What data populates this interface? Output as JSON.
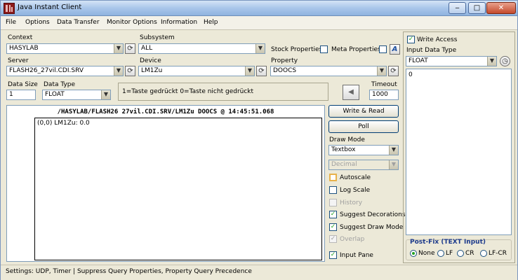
{
  "window": {
    "title": "Java Instant Client",
    "minimize": "‒",
    "maximize": "□",
    "close": "✕"
  },
  "menu": [
    "File",
    "Options",
    "Data Transfer",
    "Monitor Options",
    "Information",
    "Help"
  ],
  "context": {
    "label": "Context",
    "value": "HASYLAB"
  },
  "subsystem": {
    "label": "Subsystem",
    "value": "ALL"
  },
  "server": {
    "label": "Server",
    "value": "FLASH26_27vil.CDI.SRV"
  },
  "device": {
    "label": "Device",
    "value": "LM1Zu"
  },
  "property": {
    "label": "Property",
    "value": "DOOCS"
  },
  "stock_properties": {
    "label": "Stock Properties",
    "checked": false
  },
  "meta_properties": {
    "label": "Meta Properties",
    "checked": false
  },
  "a_button": "A",
  "data_size": {
    "label": "Data Size",
    "value": "1"
  },
  "data_type": {
    "label": "Data Type",
    "value": "FLOAT"
  },
  "info_text": "1=Taste gedrückt  0=Taste nicht gedrückt",
  "timeout": {
    "label": "Timeout",
    "value": "1000"
  },
  "display": {
    "header": "/HASYLAB/FLASH26 27vil.CDI.SRV/LM1Zu DOOCS @ 14:45:51.068",
    "line": "(0,0)  LM1Zu: 0.0"
  },
  "buttons": {
    "write_read": "Write & Read",
    "poll": "Poll"
  },
  "draw_mode": {
    "label": "Draw Mode",
    "value": "Textbox",
    "format": "Decimal"
  },
  "options": {
    "autoscale": "Autoscale",
    "log_scale": "Log Scale",
    "history": "History",
    "suggest_decorations": "Suggest Decorations",
    "suggest_draw_mode": "Suggest Draw Mode",
    "overlap": "Overlap",
    "input_pane": "Input Pane"
  },
  "right": {
    "write_access": "Write Access",
    "input_data_type_label": "Input Data Type",
    "input_data_type": "FLOAT",
    "input_value": "0",
    "postfix_title": "Post-Fix (TEXT Input)",
    "postfix_options": [
      "None",
      "LF",
      "CR",
      "LF-CR"
    ]
  },
  "status": "Settings: UDP, Timer | Suppress Query Properties, Property Query Precedence"
}
